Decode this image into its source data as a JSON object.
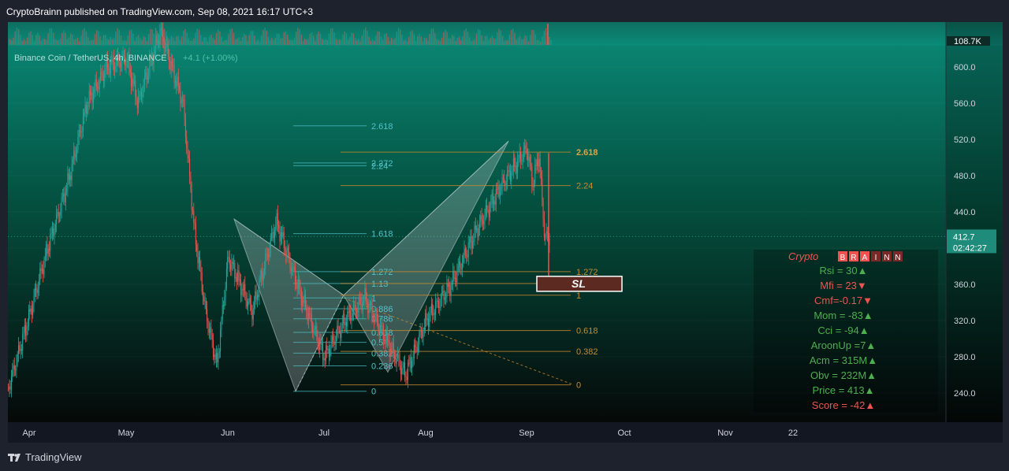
{
  "publisher_line": "CryptoBrainn published on TradingView.com, Sep 08, 2021 16:17 UTC+3",
  "footer_logo_text": "TradingView",
  "colors": {
    "bg_top": "#0a8a78",
    "bg_bottom": "#050a09",
    "up_candle": "#26a69a",
    "down_candle": "#ef5350",
    "fib_left": "#4fc3c9",
    "fib_right": "#c98a2e",
    "pattern_fill": "#cfd8dc",
    "indicator_green": "#26a69a",
    "indicator_red": "#ef5350",
    "axis_text": "#d1d4dc"
  },
  "chart_data": {
    "type": "candlestick",
    "symbol_label": "Binance Coin / TetherUS, 4h, BINANCE",
    "change_label": "+4.1 (+1.00%)",
    "volume_label": "108.7K",
    "x_ticks": [
      "Apr",
      "May",
      "Jun",
      "Jul",
      "Aug",
      "Sep",
      "Oct",
      "Nov",
      "22"
    ],
    "y_ticks": [
      "600.0",
      "560.0",
      "520.0",
      "480.0",
      "440.0",
      "400.0",
      "360.0",
      "320.0",
      "280.0",
      "240.0"
    ],
    "ylim": [
      212,
      625
    ],
    "last_price": "412.7",
    "countdown": "02:42:27",
    "approx_price_path": [
      [
        "Apr",
        245
      ],
      [
        "Apr",
        320
      ],
      [
        "Apr",
        400
      ],
      [
        "Apr",
        470
      ],
      [
        "Apr",
        560
      ],
      [
        "Apr",
        600
      ],
      [
        "May",
        610
      ],
      [
        "May",
        560
      ],
      [
        "May",
        600
      ],
      [
        "May",
        640
      ],
      [
        "May",
        600
      ],
      [
        "May",
        560
      ],
      [
        "May",
        420
      ],
      [
        "May",
        330
      ],
      [
        "May",
        270
      ],
      [
        "Jun",
        390
      ],
      [
        "Jun",
        330
      ],
      [
        "Jun",
        430
      ],
      [
        "Jun",
        350
      ],
      [
        "Jul",
        280
      ],
      [
        "Jul",
        320
      ],
      [
        "Jul",
        345
      ],
      [
        "Jul",
        300
      ],
      [
        "Jul",
        260
      ],
      [
        "Aug",
        320
      ],
      [
        "Aug",
        360
      ],
      [
        "Aug",
        420
      ],
      [
        "Aug",
        470
      ],
      [
        "Sep",
        510
      ],
      [
        "Sep",
        470
      ],
      [
        "Sep",
        505
      ],
      [
        "Sep",
        412
      ]
    ],
    "fib_left": [
      {
        "label": "2.618",
        "price": 535
      },
      {
        "label": "2.272",
        "price": 494
      },
      {
        "label": "2.24",
        "price": 491
      },
      {
        "label": "1.618",
        "price": 416
      },
      {
        "label": "1.272",
        "price": 374
      },
      {
        "label": "1.13",
        "price": 361
      },
      {
        "label": "1",
        "price": 345
      },
      {
        "label": "0.886",
        "price": 333
      },
      {
        "label": "0.786",
        "price": 322
      },
      {
        "label": "0.618",
        "price": 307
      },
      {
        "label": "0.5",
        "price": 296
      },
      {
        "label": "0.382",
        "price": 284
      },
      {
        "label": "0.236",
        "price": 270
      },
      {
        "label": "0",
        "price": 242
      }
    ],
    "fib_right": [
      {
        "label": "2.618",
        "price": 506
      },
      {
        "label": "2.24",
        "price": 469
      },
      {
        "label": "1.272",
        "price": 374
      },
      {
        "label": "1.13",
        "price": 361
      },
      {
        "label": "1",
        "price": 348
      },
      {
        "label": "0.618",
        "price": 309
      },
      {
        "label": "0.382",
        "price": 286
      },
      {
        "label": "0",
        "price": 249
      }
    ],
    "pattern_points": {
      "X": [
        "Jun",
        432
      ],
      "A": [
        "Jun",
        242
      ],
      "B": [
        "Jul",
        348
      ],
      "C": [
        "Jul",
        263
      ],
      "D": [
        "Sep",
        518
      ]
    },
    "sl_label": "SL",
    "sl_price": 361
  },
  "indicator_panel": {
    "brand_word": "Crypto",
    "brand_boxes": [
      "B",
      "R",
      "A",
      "I",
      "N",
      "N"
    ],
    "rows": [
      {
        "text": "Rsi = 30",
        "arrow": "▲",
        "color": "green"
      },
      {
        "text": "Mfi = 23",
        "arrow": "▼",
        "color": "red"
      },
      {
        "text": "Cmf=-0.17",
        "arrow": "▼",
        "color": "red"
      },
      {
        "text": "Mom = -83",
        "arrow": "▲",
        "color": "green"
      },
      {
        "text": "Cci   =  -94",
        "arrow": "▲",
        "color": "green"
      },
      {
        "text": "AroonUp =7",
        "arrow": "▲",
        "color": "green"
      },
      {
        "text": "Acm  =  315M",
        "arrow": "▲",
        "color": "green"
      },
      {
        "text": "Obv  = 232M",
        "arrow": "▲",
        "color": "green"
      },
      {
        "text": "Price  =  413",
        "arrow": "▲",
        "color": "green"
      },
      {
        "text": "Score = -42",
        "arrow": "▲",
        "color": "red"
      }
    ]
  }
}
